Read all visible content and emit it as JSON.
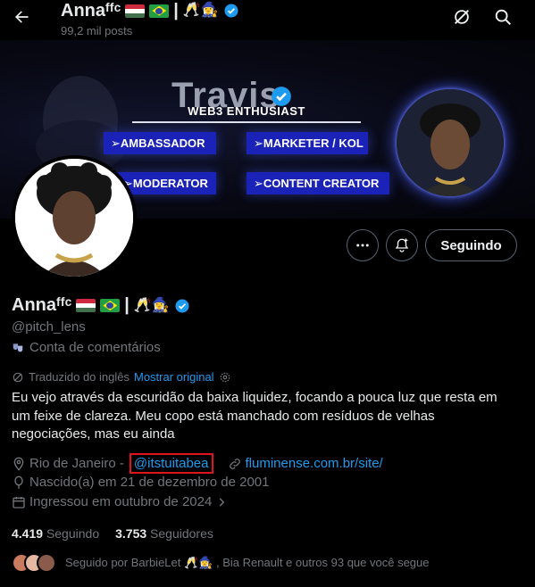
{
  "header": {
    "name": "Annaᶠᶠᶜ",
    "emojis": "🥂🧙‍♀️",
    "separator": "|",
    "posts_count": "99,2 mil posts",
    "icons": [
      "back-arrow-icon",
      "slashed-search-icon",
      "search-icon"
    ]
  },
  "banner": {
    "brand": "Travis",
    "tagline": "WEB3 ENTHUSIAST",
    "roles": [
      "➢AMBASSADOR",
      "➢MARKETER / KOL",
      "➢MODERATOR",
      "➢CONTENT CREATOR"
    ]
  },
  "actions": {
    "follow_label": "Seguindo",
    "icons": [
      "more-icon",
      "notification-bell-icon"
    ]
  },
  "profile": {
    "name": "Annaᶠᶠᶜ",
    "emojis": "🥂🧙‍♀️",
    "separator": "|",
    "handle": "@pitch_lens",
    "category": "Conta de comentários",
    "translated_from": "Traduzido do inglês",
    "show_original": "Mostrar original",
    "bio": "Eu vejo através da escuridão da baixa liquidez, focando a pouca luz que resta em um feixe de clareza. Meu copo está manchado com resíduos de velhas negociações, mas eu ainda",
    "location": "Rio de Janeiro -",
    "mention": "@itstuitabea",
    "url": "fluminense.com.br/site/",
    "birth": "Nascido(a) em 21 de dezembro de 2001",
    "joined": "Ingressou em outubro de 2024",
    "following_count": "4.419",
    "following_label": "Seguindo",
    "followers_count": "3.753",
    "followers_label": "Seguidores",
    "followed_by_prefix": "Seguido por BarbieLet",
    "followed_by_suffix": ", Bia Renault e outros 93 que você segue"
  },
  "colors": {
    "background": "#000000",
    "text": "#e7e9ea",
    "secondary": "#71767b",
    "link": "#1d9bf0",
    "highlight_box": "#e0141e",
    "banner_button": "#1a22b8"
  }
}
